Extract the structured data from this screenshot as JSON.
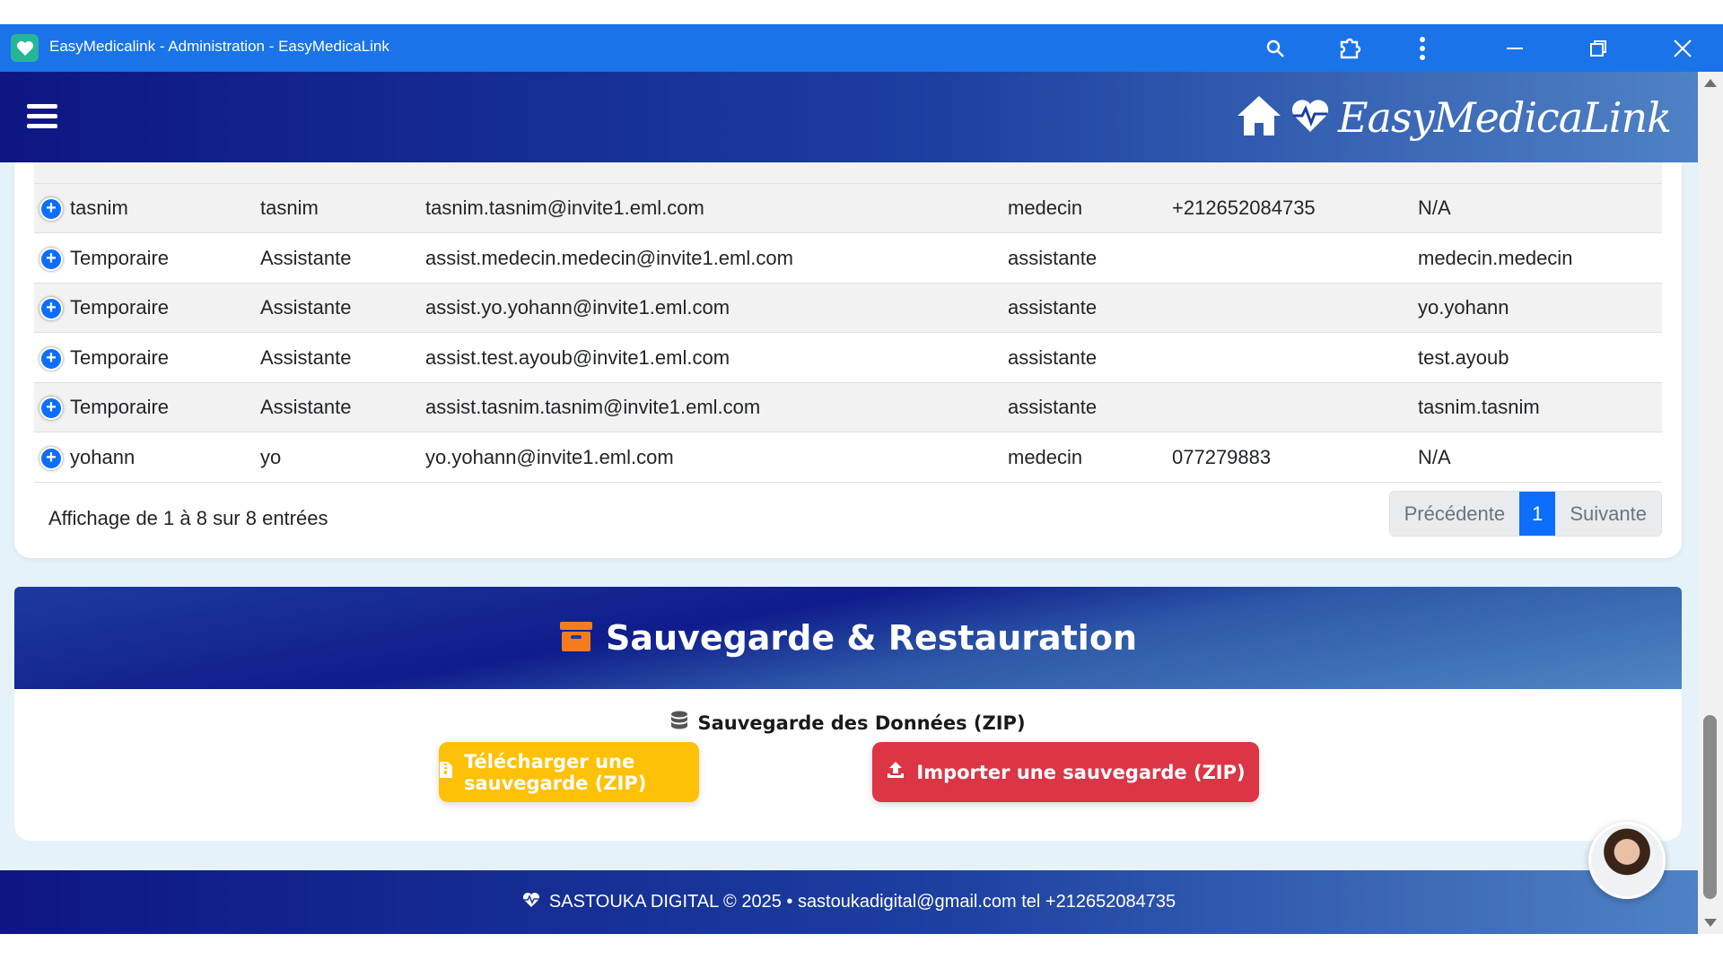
{
  "window": {
    "title": "EasyMedicalink - Administration - EasyMedicaLink",
    "icons": [
      "search-icon",
      "extension-icon",
      "more-vert-icon",
      "minimize-icon",
      "restore-icon",
      "close-icon"
    ]
  },
  "header": {
    "brand": "EasyMedicaLink",
    "icons": [
      "menu-icon",
      "home-icon",
      "heartbeat-icon"
    ]
  },
  "table": {
    "rows": [
      {
        "first": "tasnim",
        "last": "tasnim",
        "email": "tasnim.tasnim@invite1.eml.com",
        "role": "medecin",
        "phone": "+212652084735",
        "linked": "N/A"
      },
      {
        "first": "Temporaire",
        "last": "Assistante",
        "email": "assist.medecin.medecin@invite1.eml.com",
        "role": "assistante",
        "phone": "",
        "linked": "medecin.medecin"
      },
      {
        "first": "Temporaire",
        "last": "Assistante",
        "email": "assist.yo.yohann@invite1.eml.com",
        "role": "assistante",
        "phone": "",
        "linked": "yo.yohann"
      },
      {
        "first": "Temporaire",
        "last": "Assistante",
        "email": "assist.test.ayoub@invite1.eml.com",
        "role": "assistante",
        "phone": "",
        "linked": "test.ayoub"
      },
      {
        "first": "Temporaire",
        "last": "Assistante",
        "email": "assist.tasnim.tasnim@invite1.eml.com",
        "role": "assistante",
        "phone": "",
        "linked": "tasnim.tasnim"
      },
      {
        "first": "yohann",
        "last": "yo",
        "email": "yo.yohann@invite1.eml.com",
        "role": "medecin",
        "phone": "077279883",
        "linked": "N/A"
      }
    ],
    "info": "Affichage de 1 à 8 sur 8 entrées",
    "pagination": {
      "prev": "Précédente",
      "current": "1",
      "next": "Suivante"
    }
  },
  "backup": {
    "title": "Sauvegarde & Restauration",
    "subtitle": "Sauvegarde des Données (ZIP)",
    "download_label": "Télécharger une sauvegarde (ZIP)",
    "import_label": "Importer une sauvegarde (ZIP)",
    "icons": [
      "archive-icon",
      "database-icon",
      "file-zip-icon",
      "upload-icon"
    ]
  },
  "footer": {
    "text": "SASTOUKA DIGITAL © 2025 • sastoukadigital@gmail.com tel +212652084735"
  },
  "colors": {
    "titlebar": "#1a73e8",
    "header_dark": "#0d1683",
    "header_light": "#4f82c4",
    "primary": "#0d6efd",
    "warning": "#ffc107",
    "danger": "#dc3545",
    "archive_orange": "#f47c20",
    "page_bg": "#e6f2fa"
  }
}
